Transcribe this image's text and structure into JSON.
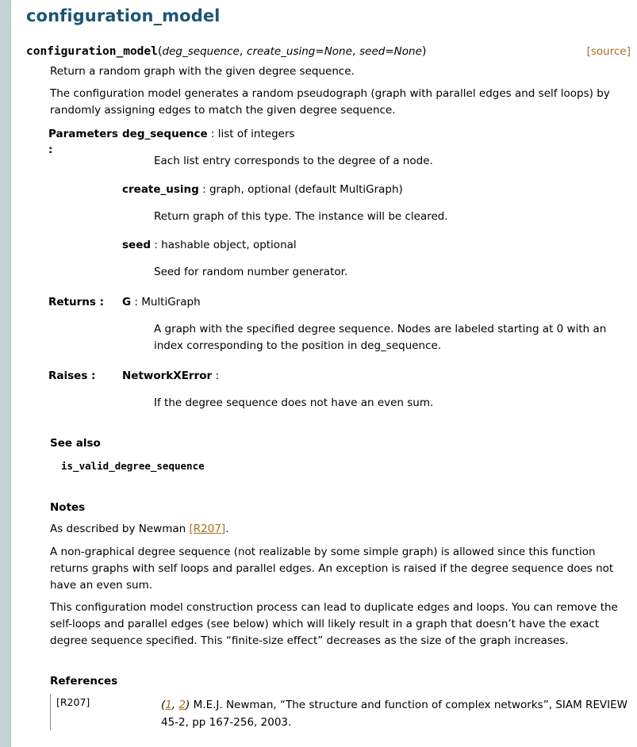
{
  "page": {
    "title": "configuration_model"
  },
  "signature": {
    "name": "configuration_model",
    "open": "(",
    "args": [
      "deg_sequence",
      "create_using=None",
      "seed=None"
    ],
    "close": ")",
    "source_label": "[source]"
  },
  "summary": "Return a random graph with the given degree sequence.",
  "description": "The configuration model generates a random pseudograph (graph with parallel edges and self loops) by randomly assigning edges to match the given degree sequence.",
  "parameters": {
    "label": "Parameters",
    "label_colon": ":",
    "items": [
      {
        "name": "deg_sequence",
        "type": " : list of integers",
        "desc": "Each list entry corresponds to the degree of a node."
      },
      {
        "name": "create_using",
        "type": " : graph, optional (default MultiGraph)",
        "desc": "Return graph of this type. The instance will be cleared."
      },
      {
        "name": "seed",
        "type": " : hashable object, optional",
        "desc": "Seed for random number generator."
      }
    ]
  },
  "returns": {
    "label": "Returns :",
    "name": "G",
    "type": " : MultiGraph",
    "desc": "A graph with the specified degree sequence. Nodes are labeled starting at 0 with an index corresponding to the position in deg_sequence."
  },
  "raises": {
    "label": "Raises :",
    "name": "NetworkXError",
    "type": " :",
    "desc": "If the degree sequence does not have an even sum."
  },
  "see_also": {
    "heading": "See also",
    "ref": "is_valid_degree_sequence"
  },
  "notes": {
    "heading": "Notes",
    "p1_prefix": "As described by Newman ",
    "p1_cite": "[R207]",
    "p1_suffix": ".",
    "p2": "A non-graphical degree sequence (not realizable by some simple graph) is allowed since this function returns graphs with self loops and parallel edges. An exception is raised if the degree sequence does not have an even sum.",
    "p3": "This configuration model construction process can lead to duplicate edges and loops. You can remove the self-loops and parallel edges (see below) which will likely result in a graph that doesn’t have the exact degree sequence specified. This “finite-size effect” decreases as the size of the graph increases."
  },
  "references": {
    "heading": "References",
    "label": "[R207]",
    "backref_open": "(",
    "backref_1": "1",
    "backref_sep": ", ",
    "backref_2": "2",
    "backref_close": ")",
    "text": " M.E.J. Newman, “The structure and function of complex networks”, SIAM REVIEW 45-2, pp 167-256, 2003."
  }
}
